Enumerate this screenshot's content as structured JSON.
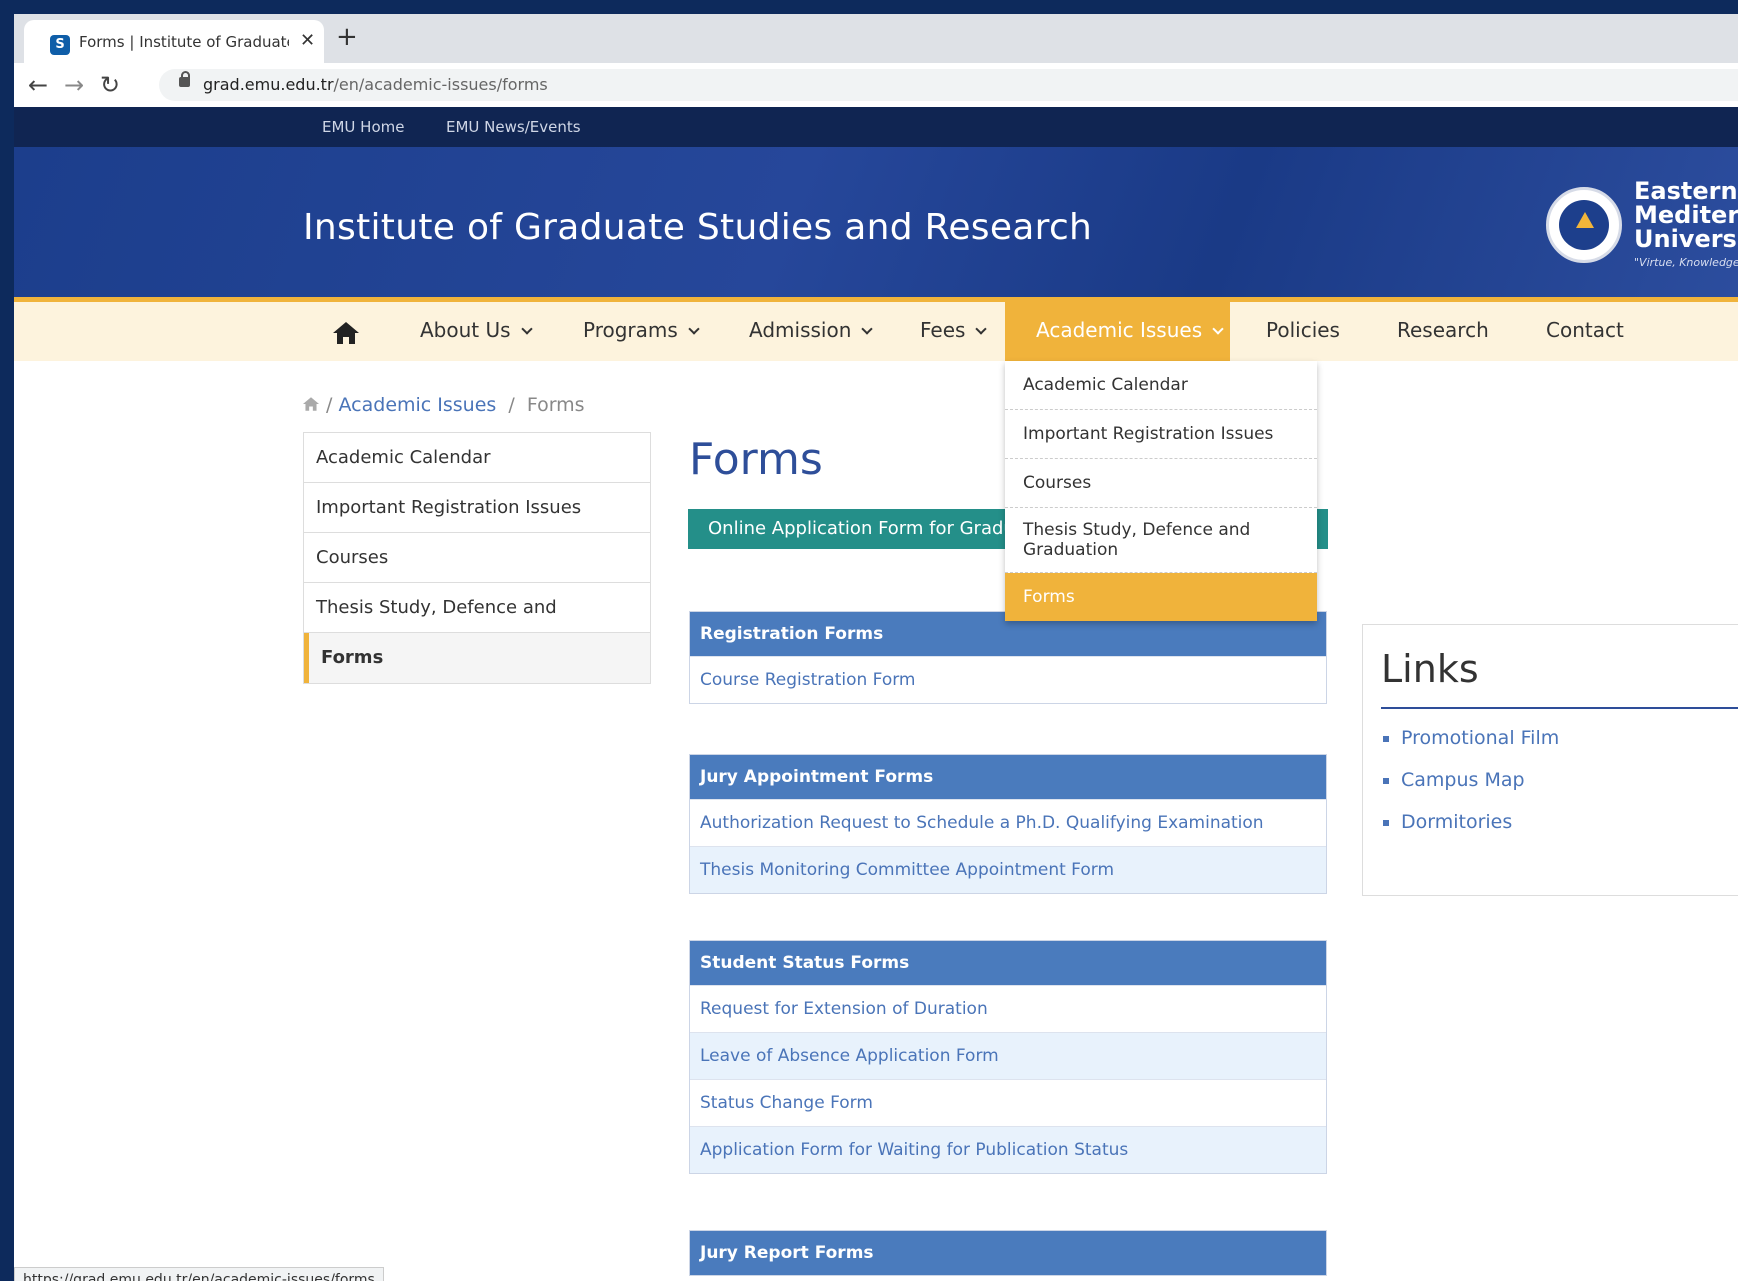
{
  "browser": {
    "tab_title": "Forms | Institute of Graduate Stu",
    "tab_close": "✕",
    "new_tab": "+",
    "url_domain": "grad.emu.edu.tr",
    "url_path": "/en/academic-issues/forms",
    "back": "←",
    "forward": "→",
    "reload": "↻"
  },
  "topnav": {
    "home": "EMU Home",
    "news": "EMU News/Events"
  },
  "header": {
    "site_title": "Institute of Graduate Studies and Research",
    "logo_line1": "Eastern",
    "logo_line2": "Mediterra",
    "logo_line3": "Universit",
    "logo_motto": "\"Virtue, Knowledge,"
  },
  "mainnav": {
    "items": [
      {
        "label": "About Us"
      },
      {
        "label": "Programs"
      },
      {
        "label": "Admission"
      },
      {
        "label": "Fees"
      },
      {
        "label": "Academic Issues"
      },
      {
        "label": "Policies"
      },
      {
        "label": "Research"
      },
      {
        "label": "Contact"
      }
    ]
  },
  "breadcrumb": {
    "sep": "/",
    "level1": "Academic Issues",
    "level2": "Forms"
  },
  "sidemenu": {
    "items": [
      {
        "label": "Academic Calendar"
      },
      {
        "label": "Important Registration Issues"
      },
      {
        "label": "Courses"
      },
      {
        "label": "Thesis Study, Defence and Graduation"
      },
      {
        "label": "Forms"
      }
    ]
  },
  "dropdown": {
    "items": [
      {
        "label": "Academic Calendar"
      },
      {
        "label": "Important Registration Issues"
      },
      {
        "label": "Courses"
      },
      {
        "label": "Thesis Study, Defence and Graduation"
      },
      {
        "label": "Forms"
      }
    ]
  },
  "main": {
    "title": "Forms",
    "online_button": "Online Application Form for Graduate",
    "sections": [
      {
        "title": "Registration Forms",
        "rows": [
          "Course Registration Form"
        ]
      },
      {
        "title": "Jury Appointment Forms",
        "rows": [
          "Authorization Request to Schedule a Ph.D. Qualifying Examination",
          "Thesis Monitoring Committee Appointment Form"
        ]
      },
      {
        "title": "Student Status Forms",
        "rows": [
          "Request for Extension of Duration",
          "Leave of Absence Application Form",
          "Status Change Form",
          "Application Form for Waiting for Publication Status"
        ]
      },
      {
        "title": "Jury Report Forms",
        "rows": []
      }
    ]
  },
  "links": {
    "title": "Links",
    "items": [
      "Promotional Film",
      "Campus Map",
      "Dormitories"
    ]
  },
  "statusbar": {
    "url": "https://grad.emu.edu.tr/en/academic-issues/forms"
  },
  "colors": {
    "accent": "#f0b33b",
    "brand": "#1c3e8c",
    "teal": "#248f89",
    "table_header": "#4a7bbd"
  }
}
